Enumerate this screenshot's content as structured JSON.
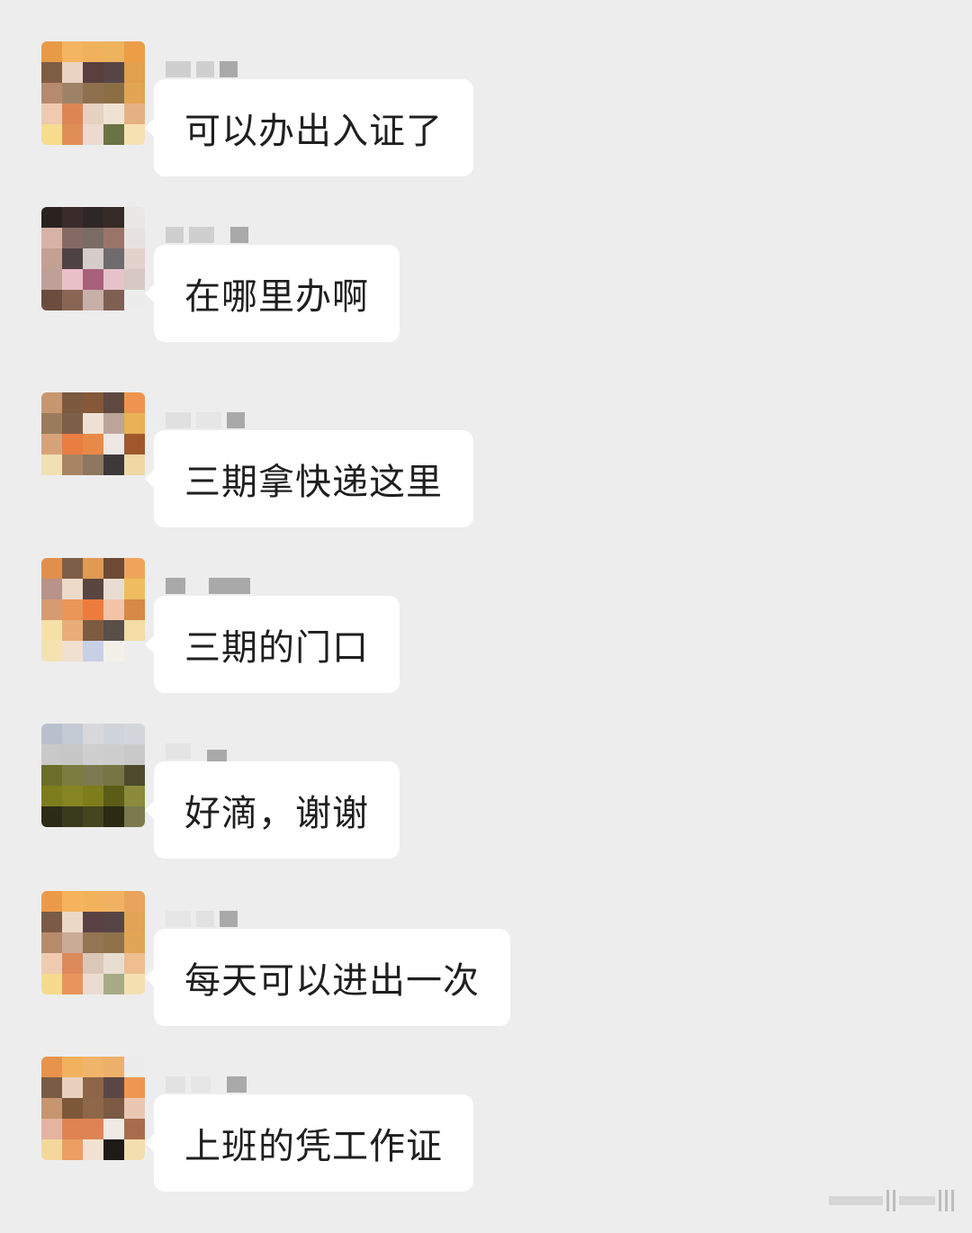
{
  "messages": [
    {
      "text": "可以办出入证了"
    },
    {
      "text": "在哪里办啊"
    },
    {
      "text": "三期拿快递这里"
    },
    {
      "text": "三期的门口"
    },
    {
      "text": "好滴，谢谢"
    },
    {
      "text": "每天可以进出一次"
    },
    {
      "text": "上班的凭工作证"
    }
  ],
  "colors": {
    "background": "#ededed",
    "bubble": "#ffffff",
    "text": "#1f1f1f"
  }
}
